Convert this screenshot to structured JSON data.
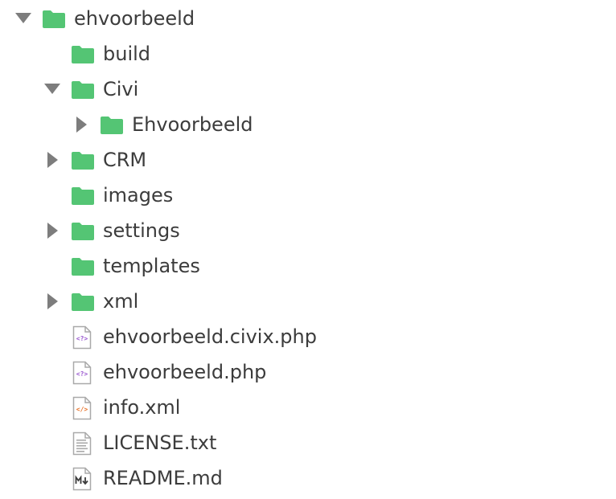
{
  "colors": {
    "folder": "#54c574",
    "caret": "#7d7d7d",
    "text": "#3c3c3c",
    "php": "#9b59d0",
    "xml": "#e8732a",
    "file_border": "#a9a9a9"
  },
  "tree": {
    "items": [
      {
        "label": "ehvoorbeeld",
        "type": "folder",
        "state": "expanded",
        "icon": "folder-icon"
      },
      {
        "label": "build",
        "type": "folder",
        "state": "leaf",
        "icon": "folder-icon"
      },
      {
        "label": "Civi",
        "type": "folder",
        "state": "expanded",
        "icon": "folder-icon"
      },
      {
        "label": "Ehvoorbeeld",
        "type": "folder",
        "state": "collapsed",
        "icon": "folder-icon"
      },
      {
        "label": "CRM",
        "type": "folder",
        "state": "collapsed",
        "icon": "folder-icon"
      },
      {
        "label": "images",
        "type": "folder",
        "state": "leaf",
        "icon": "folder-icon"
      },
      {
        "label": "settings",
        "type": "folder",
        "state": "collapsed",
        "icon": "folder-icon"
      },
      {
        "label": "templates",
        "type": "folder",
        "state": "leaf",
        "icon": "folder-icon"
      },
      {
        "label": "xml",
        "type": "folder",
        "state": "collapsed",
        "icon": "folder-icon"
      },
      {
        "label": "ehvoorbeeld.civix.php",
        "type": "file",
        "icon": "php-file-icon"
      },
      {
        "label": "ehvoorbeeld.php",
        "type": "file",
        "icon": "php-file-icon"
      },
      {
        "label": "info.xml",
        "type": "file",
        "icon": "xml-file-icon"
      },
      {
        "label": "LICENSE.txt",
        "type": "file",
        "icon": "text-file-icon"
      },
      {
        "label": "README.md",
        "type": "file",
        "icon": "markdown-file-icon"
      }
    ]
  }
}
